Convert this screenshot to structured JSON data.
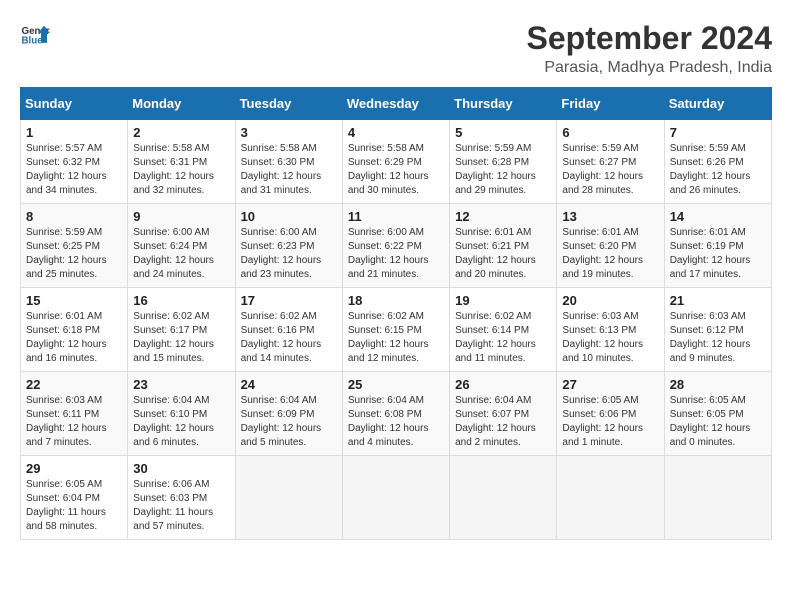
{
  "logo": {
    "general": "General",
    "blue": "Blue"
  },
  "title": "September 2024",
  "location": "Parasia, Madhya Pradesh, India",
  "days_header": [
    "Sunday",
    "Monday",
    "Tuesday",
    "Wednesday",
    "Thursday",
    "Friday",
    "Saturday"
  ],
  "weeks": [
    [
      {
        "day": "1",
        "sunrise": "5:57 AM",
        "sunset": "6:32 PM",
        "daylight": "12 hours and 34 minutes."
      },
      {
        "day": "2",
        "sunrise": "5:58 AM",
        "sunset": "6:31 PM",
        "daylight": "12 hours and 32 minutes."
      },
      {
        "day": "3",
        "sunrise": "5:58 AM",
        "sunset": "6:30 PM",
        "daylight": "12 hours and 31 minutes."
      },
      {
        "day": "4",
        "sunrise": "5:58 AM",
        "sunset": "6:29 PM",
        "daylight": "12 hours and 30 minutes."
      },
      {
        "day": "5",
        "sunrise": "5:59 AM",
        "sunset": "6:28 PM",
        "daylight": "12 hours and 29 minutes."
      },
      {
        "day": "6",
        "sunrise": "5:59 AM",
        "sunset": "6:27 PM",
        "daylight": "12 hours and 28 minutes."
      },
      {
        "day": "7",
        "sunrise": "5:59 AM",
        "sunset": "6:26 PM",
        "daylight": "12 hours and 26 minutes."
      }
    ],
    [
      {
        "day": "8",
        "sunrise": "5:59 AM",
        "sunset": "6:25 PM",
        "daylight": "12 hours and 25 minutes."
      },
      {
        "day": "9",
        "sunrise": "6:00 AM",
        "sunset": "6:24 PM",
        "daylight": "12 hours and 24 minutes."
      },
      {
        "day": "10",
        "sunrise": "6:00 AM",
        "sunset": "6:23 PM",
        "daylight": "12 hours and 23 minutes."
      },
      {
        "day": "11",
        "sunrise": "6:00 AM",
        "sunset": "6:22 PM",
        "daylight": "12 hours and 21 minutes."
      },
      {
        "day": "12",
        "sunrise": "6:01 AM",
        "sunset": "6:21 PM",
        "daylight": "12 hours and 20 minutes."
      },
      {
        "day": "13",
        "sunrise": "6:01 AM",
        "sunset": "6:20 PM",
        "daylight": "12 hours and 19 minutes."
      },
      {
        "day": "14",
        "sunrise": "6:01 AM",
        "sunset": "6:19 PM",
        "daylight": "12 hours and 17 minutes."
      }
    ],
    [
      {
        "day": "15",
        "sunrise": "6:01 AM",
        "sunset": "6:18 PM",
        "daylight": "12 hours and 16 minutes."
      },
      {
        "day": "16",
        "sunrise": "6:02 AM",
        "sunset": "6:17 PM",
        "daylight": "12 hours and 15 minutes."
      },
      {
        "day": "17",
        "sunrise": "6:02 AM",
        "sunset": "6:16 PM",
        "daylight": "12 hours and 14 minutes."
      },
      {
        "day": "18",
        "sunrise": "6:02 AM",
        "sunset": "6:15 PM",
        "daylight": "12 hours and 12 minutes."
      },
      {
        "day": "19",
        "sunrise": "6:02 AM",
        "sunset": "6:14 PM",
        "daylight": "12 hours and 11 minutes."
      },
      {
        "day": "20",
        "sunrise": "6:03 AM",
        "sunset": "6:13 PM",
        "daylight": "12 hours and 10 minutes."
      },
      {
        "day": "21",
        "sunrise": "6:03 AM",
        "sunset": "6:12 PM",
        "daylight": "12 hours and 9 minutes."
      }
    ],
    [
      {
        "day": "22",
        "sunrise": "6:03 AM",
        "sunset": "6:11 PM",
        "daylight": "12 hours and 7 minutes."
      },
      {
        "day": "23",
        "sunrise": "6:04 AM",
        "sunset": "6:10 PM",
        "daylight": "12 hours and 6 minutes."
      },
      {
        "day": "24",
        "sunrise": "6:04 AM",
        "sunset": "6:09 PM",
        "daylight": "12 hours and 5 minutes."
      },
      {
        "day": "25",
        "sunrise": "6:04 AM",
        "sunset": "6:08 PM",
        "daylight": "12 hours and 4 minutes."
      },
      {
        "day": "26",
        "sunrise": "6:04 AM",
        "sunset": "6:07 PM",
        "daylight": "12 hours and 2 minutes."
      },
      {
        "day": "27",
        "sunrise": "6:05 AM",
        "sunset": "6:06 PM",
        "daylight": "12 hours and 1 minute."
      },
      {
        "day": "28",
        "sunrise": "6:05 AM",
        "sunset": "6:05 PM",
        "daylight": "12 hours and 0 minutes."
      }
    ],
    [
      {
        "day": "29",
        "sunrise": "6:05 AM",
        "sunset": "6:04 PM",
        "daylight": "11 hours and 58 minutes."
      },
      {
        "day": "30",
        "sunrise": "6:06 AM",
        "sunset": "6:03 PM",
        "daylight": "11 hours and 57 minutes."
      },
      null,
      null,
      null,
      null,
      null
    ]
  ]
}
